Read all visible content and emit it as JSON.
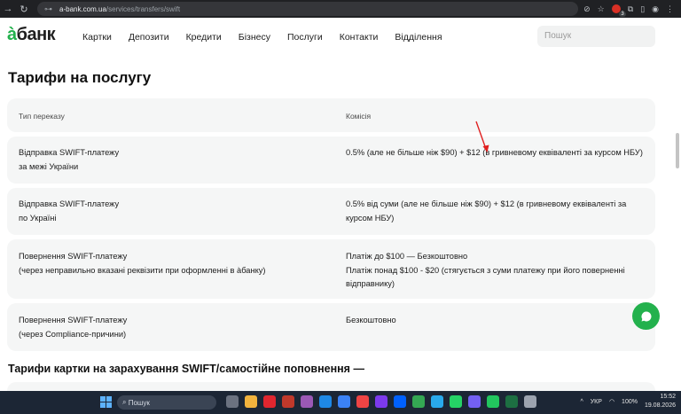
{
  "browser": {
    "url_host": "a-bank.com.ua",
    "url_path": "/services/transfers/swift",
    "ext_badge_count": "3"
  },
  "header": {
    "logo_accent": "à",
    "logo_rest": "банк",
    "nav": [
      "Картки",
      "Депозити",
      "Кредити",
      "Бізнесу",
      "Послуги",
      "Контакти",
      "Відділення"
    ],
    "search_placeholder": "Пошук"
  },
  "main": {
    "title": "Тарифи на послугу",
    "table": {
      "headers": [
        "Тип переказу",
        "Комісія"
      ],
      "rows": [
        {
          "type": [
            "Відправка SWIFT-платежу",
            "за межі України"
          ],
          "fee": "0.5% (але не більше ніж $90) + $12 (в гривневому еквіваленті за курсом НБУ)"
        },
        {
          "type": [
            "Відправка SWIFT-платежу",
            "по Україні"
          ],
          "fee": "0.5% від суми (але не більше ніж $90) + $12 (в гривневому еквіваленті за курсом НБУ)"
        },
        {
          "type": [
            "Повернення SWIFT-платежу",
            "(через неправильно вказані реквізити при оформленні в àбанку)"
          ],
          "fee": [
            "Платіж до $100 — Безкоштовно",
            "Платіж понад $100 - $20 (стягується з суми платежу при його поверненні відправнику)"
          ]
        },
        {
          "type": [
            "Повернення SWIFT-платежу",
            "(через Compliance-причини)"
          ],
          "fee": "Безкоштовно"
        }
      ]
    },
    "subtitle": "Тарифи картки на зарахування SWIFT/самостійне поповнення —"
  },
  "taskbar": {
    "search_label": "Пошук",
    "lang": "УКР",
    "battery": "100%",
    "time": "15:52",
    "date": "19.08.2026"
  },
  "colors": {
    "brand": "#23b14d",
    "row_bg": "#f5f6f6",
    "annotation": "#e02020"
  }
}
